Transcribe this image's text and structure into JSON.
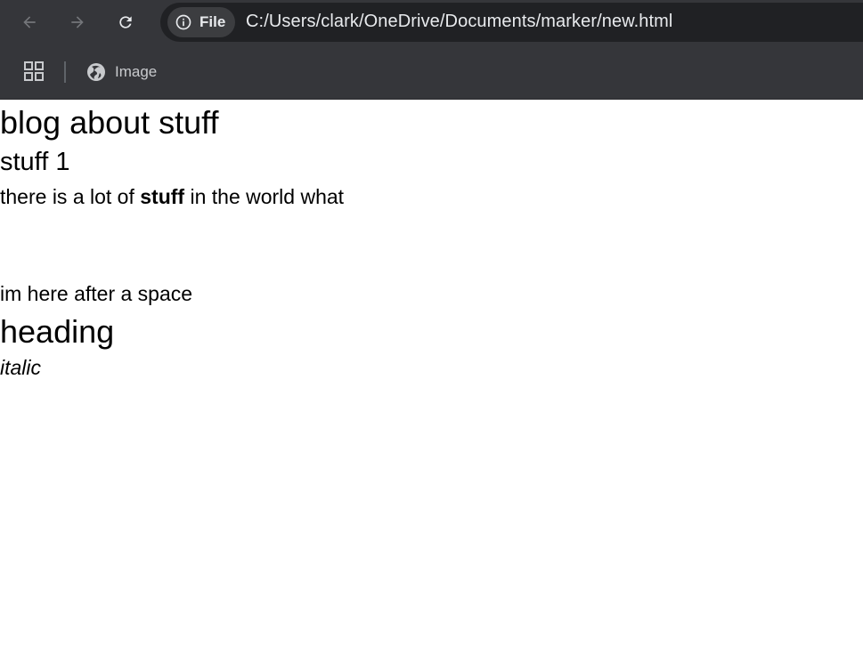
{
  "browser": {
    "back_icon": "arrow-left-icon",
    "forward_icon": "arrow-right-icon",
    "reload_icon": "reload-icon",
    "site_info_icon": "info-circle-icon",
    "site_info_label": "File",
    "url": "C:/Users/clark/OneDrive/Documents/marker/new.html"
  },
  "bookmarks": {
    "apps_icon": "apps-grid-icon",
    "items": [
      {
        "icon": "globe-icon",
        "label": "Image"
      }
    ]
  },
  "page": {
    "title": "blog about stuff",
    "subheading": "stuff 1",
    "paragraph1": {
      "before": "there is a lot of ",
      "bold": "stuff",
      "after": " in the world what"
    },
    "paragraph2": "im here after a space",
    "heading2": "heading",
    "italic_text": "italic"
  },
  "colors": {
    "toolbar": "#35363a",
    "omnibox": "#202124",
    "chip": "#3c3d40",
    "text_light": "#e8eaed",
    "icon_disabled": "#8a8b8e",
    "page_background": "#ffffff"
  }
}
